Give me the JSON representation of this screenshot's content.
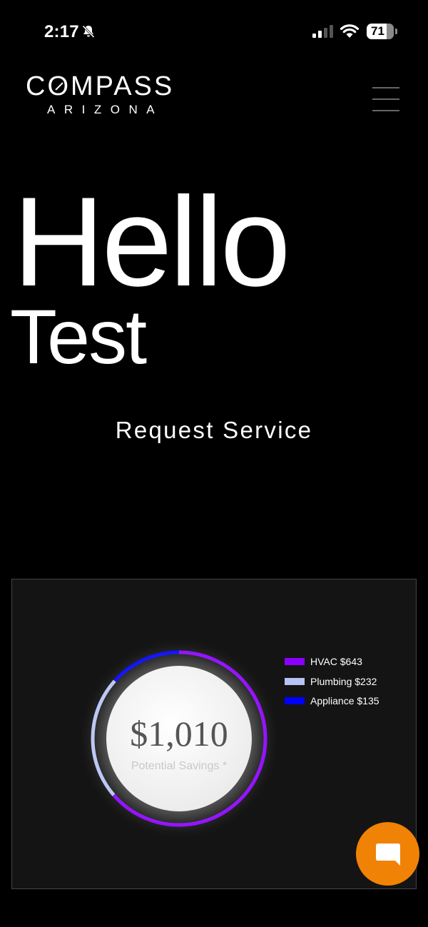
{
  "status_bar": {
    "time": "2:17",
    "battery": "71",
    "icons": [
      "bell-slash-icon",
      "cellular-signal-icon",
      "wifi-icon",
      "battery-icon"
    ]
  },
  "header": {
    "logo_main_prefix": "C",
    "logo_main_o": "O",
    "logo_main_suffix": "MPASS",
    "logo_sub": "ARIZONA",
    "menu_icon": "hamburger-menu-icon"
  },
  "greeting": {
    "hello": "Hello",
    "name": "Test"
  },
  "request_service_label": "Request Service",
  "savings": {
    "amount": "$1,010",
    "label": "Potential Savings *"
  },
  "chart_data": {
    "type": "pie",
    "title": "",
    "categories": [
      "HVAC",
      "Plumbing",
      "Appliance"
    ],
    "values": [
      643,
      232,
      135
    ],
    "legend": [
      "HVAC $643",
      "Plumbing $232",
      "Appliance $135"
    ],
    "colors": [
      "#8b00ff",
      "#b7c3f3",
      "#0000ff"
    ],
    "total": 1010,
    "legend_placement": "right"
  },
  "chat_button": {
    "icon": "chat-bubble-icon",
    "color": "#f08205"
  }
}
